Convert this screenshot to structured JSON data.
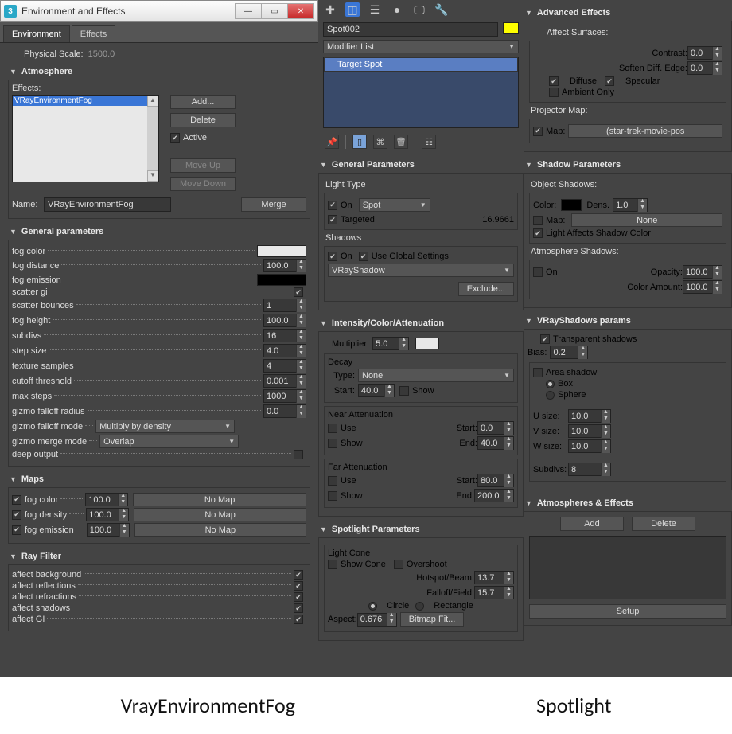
{
  "window": {
    "title": "Environment and Effects",
    "tabs": [
      "Environment",
      "Effects"
    ],
    "active_tab": "Environment"
  },
  "physical_scale": {
    "label": "Physical Scale:",
    "value": "1500.0"
  },
  "atmosphere": {
    "title": "Atmosphere",
    "effects_label": "Effects:",
    "selected": "VRayEnvironmentFog",
    "add": "Add...",
    "delete": "Delete",
    "active": "Active",
    "moveup": "Move Up",
    "movedown": "Move Down",
    "merge": "Merge",
    "name_label": "Name:",
    "name_value": "VRayEnvironmentFog"
  },
  "general": {
    "title": "General parameters",
    "fog_color": "fog color",
    "fog_distance": "fog distance",
    "fog_distance_v": "100.0",
    "fog_emission": "fog emission",
    "scatter_gi": "scatter gi",
    "scatter_bounces": "scatter bounces",
    "scatter_bounces_v": "1",
    "fog_height": "fog height",
    "fog_height_v": "100.0",
    "subdivs": "subdivs",
    "subdivs_v": "16",
    "step_size": "step size",
    "step_size_v": "4.0",
    "texture_samples": "texture samples",
    "texture_samples_v": "4",
    "cutoff": "cutoff threshold",
    "cutoff_v": "0.001",
    "max_steps": "max steps",
    "max_steps_v": "1000",
    "gizmo_radius": "gizmo falloff radius",
    "gizmo_radius_v": "0.0",
    "gizmo_falloff": "gizmo falloff mode",
    "gizmo_falloff_v": "Multiply by density",
    "gizmo_merge": "gizmo merge mode",
    "gizmo_merge_v": "Overlap",
    "deep_output": "deep output"
  },
  "maps": {
    "title": "Maps",
    "nomap": "No Map",
    "items": [
      {
        "label": "fog color",
        "val": "100.0"
      },
      {
        "label": "fog density",
        "val": "100.0"
      },
      {
        "label": "fog emission",
        "val": "100.0"
      }
    ]
  },
  "rayfilter": {
    "title": "Ray Filter",
    "items": [
      "affect background",
      "affect reflections",
      "affect refractions",
      "affect shadows",
      "affect GI"
    ]
  },
  "objname": "Spot002",
  "modlist": "Modifier List",
  "target_spot": "Target Spot",
  "gp": {
    "title": "General Parameters",
    "lighttype": "Light Type",
    "on": "On",
    "spot": "Spot",
    "targeted": "Targeted",
    "targeted_v": "16.9661",
    "shadows": "Shadows",
    "use_global": "Use Global Settings",
    "shadow_type": "VRayShadow",
    "exclude": "Exclude..."
  },
  "ica": {
    "title": "Intensity/Color/Attenuation",
    "multiplier": "Multiplier:",
    "multiplier_v": "5.0",
    "decay": "Decay",
    "type": "Type:",
    "type_v": "None",
    "start": "Start:",
    "start_v": "40.0",
    "show": "Show",
    "near": "Near Attenuation",
    "near_start": "0.0",
    "near_end": "40.0",
    "far": "Far Attenuation",
    "far_start": "80.0",
    "far_end": "200.0",
    "use": "Use",
    "end": "End:"
  },
  "sp": {
    "title": "Spotlight Parameters",
    "cone": "Light Cone",
    "showcone": "Show Cone",
    "overshoot": "Overshoot",
    "hotspot": "Hotspot/Beam:",
    "hotspot_v": "13.7",
    "falloff": "Falloff/Field:",
    "falloff_v": "15.7",
    "circle": "Circle",
    "rect": "Rectangle",
    "aspect": "Aspect:",
    "aspect_v": "0.676",
    "bitmap": "Bitmap Fit..."
  },
  "adv": {
    "title": "Advanced Effects",
    "aff": "Affect Surfaces:",
    "contrast": "Contrast:",
    "contrast_v": "0.0",
    "soft": "Soften Diff. Edge:",
    "soft_v": "0.0",
    "diffuse": "Diffuse",
    "specular": "Specular",
    "ambient": "Ambient Only",
    "projmap": "Projector Map:",
    "map": "Map:",
    "map_v": "(star-trek-movie-pos"
  },
  "shadow": {
    "title": "Shadow Parameters",
    "obj": "Object Shadows:",
    "color": "Color:",
    "dens": "Dens.",
    "dens_v": "1.0",
    "map": "Map:",
    "none": "None",
    "lasc": "Light Affects Shadow Color",
    "atmo": "Atmosphere Shadows:",
    "on": "On",
    "opacity": "Opacity:",
    "opacity_v": "100.0",
    "camt": "Color Amount:",
    "camt_v": "100.0"
  },
  "vs": {
    "title": "VRayShadows params",
    "trans": "Transparent shadows",
    "bias": "Bias:",
    "bias_v": "0.2",
    "area": "Area shadow",
    "box": "Box",
    "sphere": "Sphere",
    "usize": "U size:",
    "usize_v": "10.0",
    "vsize": "V size:",
    "vsize_v": "10.0",
    "wsize": "W size:",
    "wsize_v": "10.0",
    "subdivs": "Subdivs:",
    "subdivs_v": "8"
  },
  "ae": {
    "title": "Atmospheres & Effects",
    "add": "Add",
    "delete": "Delete",
    "setup": "Setup"
  },
  "labels": {
    "left": "VrayEnvironmentFog",
    "right": "Spotlight"
  }
}
